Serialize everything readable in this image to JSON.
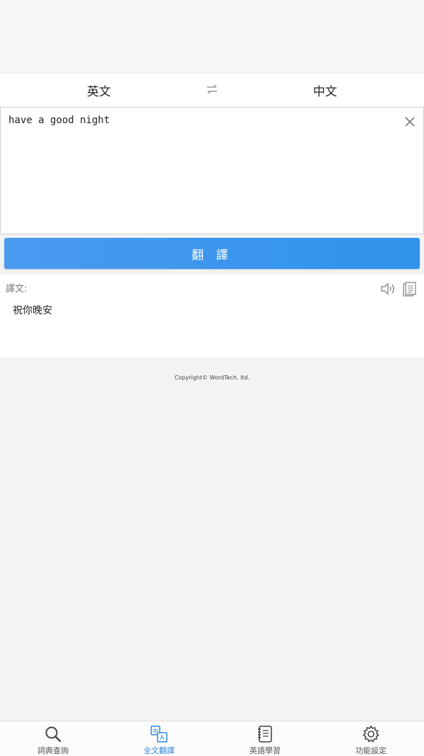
{
  "lang_bar": {
    "source": "英文",
    "swap_icon": "swap-arrows-icon",
    "target": "中文"
  },
  "input": {
    "text": "have a good night",
    "clear_icon": "close-icon"
  },
  "translate_button": {
    "label": "翻 譯"
  },
  "result": {
    "label": "譯文:",
    "text": "祝你晚安",
    "speaker_icon": "speaker-icon",
    "copy_icon": "copy-icon"
  },
  "footer": {
    "copyright": "Copyright© WordTech. ltd."
  },
  "tabs": [
    {
      "label": "詞典查詢",
      "icon": "search-icon",
      "active": false
    },
    {
      "label": "全文翻譯",
      "icon": "translate-icon",
      "active": true
    },
    {
      "label": "英語學習",
      "icon": "notebook-icon",
      "active": false
    },
    {
      "label": "功能設定",
      "icon": "gear-icon",
      "active": false
    }
  ],
  "colors": {
    "accent": "#2f93ea",
    "active_tab": "#2d88e0"
  }
}
